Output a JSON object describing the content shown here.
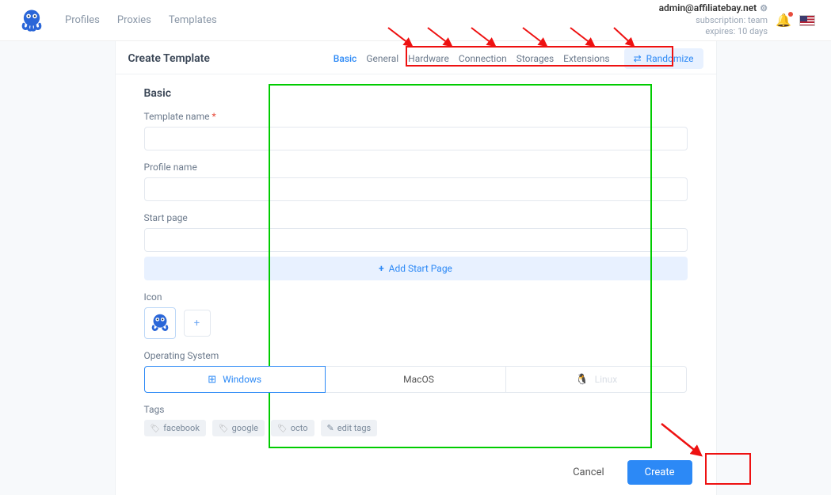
{
  "header": {
    "nav": {
      "profiles": "Profiles",
      "proxies": "Proxies",
      "templates": "Templates"
    },
    "user": {
      "email": "admin@affiliatebay.net",
      "sub_line1": "subscription: team",
      "sub_line2": "expires: 10 days"
    }
  },
  "panel": {
    "title": "Create Template",
    "tabs": {
      "basic": "Basic",
      "general": "General",
      "hardware": "Hardware",
      "connection": "Connection",
      "storages": "Storages",
      "extensions": "Extensions"
    },
    "randomize": "Randomize"
  },
  "form": {
    "section_title": "Basic",
    "template_name_label": "Template name",
    "profile_name_label": "Profile name",
    "start_page_label": "Start page",
    "add_start_page": "Add Start Page",
    "icon_label": "Icon",
    "os_label": "Operating System",
    "os": {
      "windows": "Windows",
      "macos": "MacOS",
      "linux": "Linux"
    },
    "tags_label": "Tags",
    "tags": {
      "facebook": "facebook",
      "google": "google",
      "octo": "octo",
      "edit": "edit tags"
    }
  },
  "actions": {
    "cancel": "Cancel",
    "create": "Create"
  }
}
